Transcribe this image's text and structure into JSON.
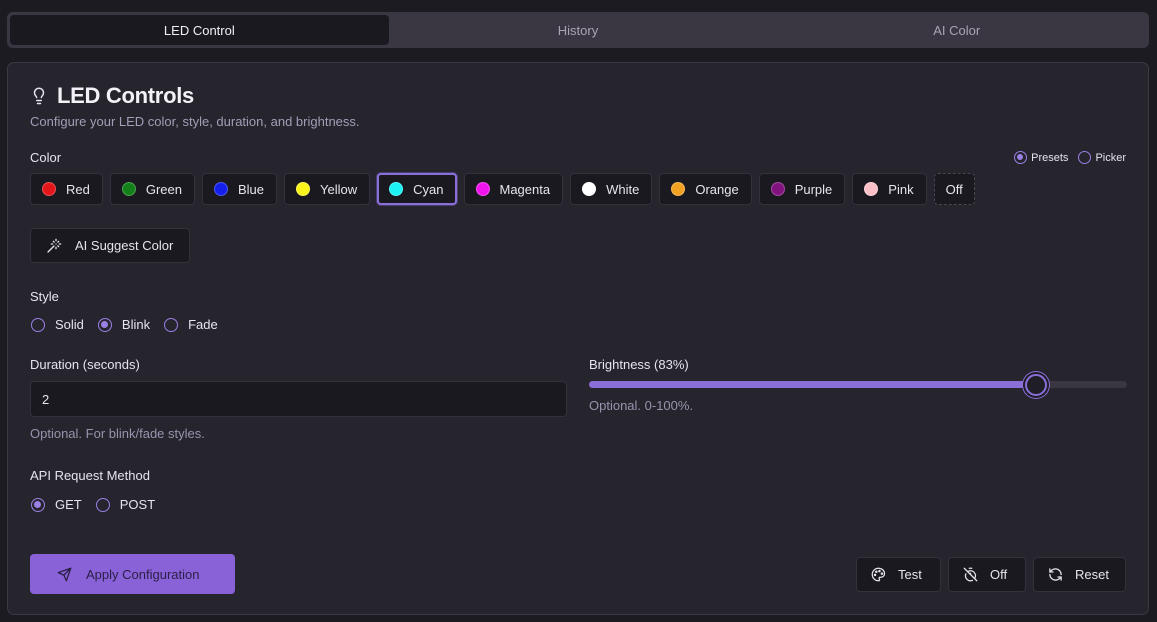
{
  "tabs": [
    {
      "label": "LED Control",
      "active": true
    },
    {
      "label": "History",
      "active": false
    },
    {
      "label": "AI Color",
      "active": false
    }
  ],
  "card": {
    "title": "LED Controls",
    "title_icon": "lightbulb-icon",
    "subtitle": "Configure your LED color, style, duration, and brightness."
  },
  "color": {
    "label": "Color",
    "mode_options": [
      {
        "label": "Presets",
        "selected": true
      },
      {
        "label": "Picker",
        "selected": false
      }
    ],
    "presets": [
      {
        "label": "Red",
        "hex": "#e3161b"
      },
      {
        "label": "Green",
        "hex": "#138019"
      },
      {
        "label": "Blue",
        "hex": "#1220ea"
      },
      {
        "label": "Yellow",
        "hex": "#fbf41a"
      },
      {
        "label": "Cyan",
        "hex": "#1cf2f4"
      },
      {
        "label": "Magenta",
        "hex": "#ef14ee"
      },
      {
        "label": "White",
        "hex": "#ffffff"
      },
      {
        "label": "Orange",
        "hex": "#f3a123"
      },
      {
        "label": "Purple",
        "hex": "#81137f"
      },
      {
        "label": "Pink",
        "hex": "#fcc1c8"
      }
    ],
    "selected": "Cyan",
    "off_label": "Off",
    "ai_suggest_label": "AI Suggest Color"
  },
  "style": {
    "label": "Style",
    "options": [
      {
        "label": "Solid",
        "selected": false
      },
      {
        "label": "Blink",
        "selected": true
      },
      {
        "label": "Fade",
        "selected": false
      }
    ]
  },
  "duration": {
    "label": "Duration (seconds)",
    "value": "2",
    "hint": "Optional. For blink/fade styles."
  },
  "brightness": {
    "label": "Brightness (83%)",
    "value_percent": 83,
    "hint": "Optional. 0-100%."
  },
  "api_method": {
    "label": "API Request Method",
    "options": [
      {
        "label": "GET",
        "selected": true
      },
      {
        "label": "POST",
        "selected": false
      }
    ]
  },
  "actions": {
    "apply_label": "Apply Configuration",
    "test_label": "Test",
    "off_label": "Off",
    "reset_label": "Reset"
  },
  "colors": {
    "accent": "#8a6fd9",
    "background": "#1c1b22",
    "card": "#26242d"
  }
}
